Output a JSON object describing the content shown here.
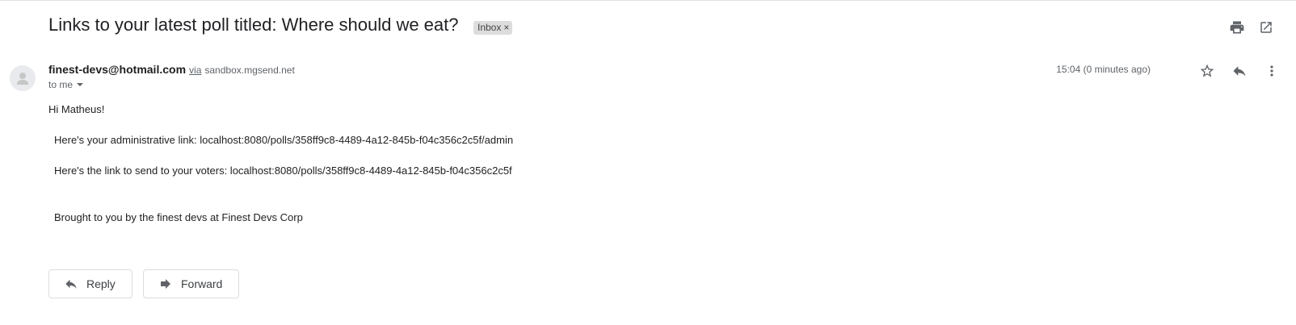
{
  "email": {
    "subject": "Links to your latest poll titled: Where should we eat?",
    "label": "Inbox",
    "label_remove": "×",
    "sender_email": "finest-devs@hotmail.com",
    "via_text": "via",
    "via_domain": "sandbox.mgsend.net",
    "recipient_text": "to me",
    "timestamp": "15:04 (0 minutes ago)",
    "body": {
      "greeting": "Hi Matheus!",
      "admin_line": "Here's your administrative link: localhost:8080/polls/358ff9c8-4489-4a12-845b-f04c356c2c5f/admin",
      "voter_line": "Here's the link to send to your voters: localhost:8080/polls/358ff9c8-4489-4a12-845b-f04c356c2c5f",
      "signature": "Brought to you by the finest devs at Finest Devs Corp"
    }
  },
  "actions": {
    "reply_label": "Reply",
    "forward_label": "Forward"
  },
  "icons": {
    "print": "print-icon",
    "open_new_window": "open-in-new-window-icon",
    "star": "star-icon",
    "reply": "reply-icon",
    "more": "more-vert-icon",
    "forward": "forward-icon",
    "avatar": "default-avatar-icon"
  },
  "colors": {
    "label_bg": "#dddddd",
    "icon": "#5f6368",
    "text": "#202124"
  }
}
